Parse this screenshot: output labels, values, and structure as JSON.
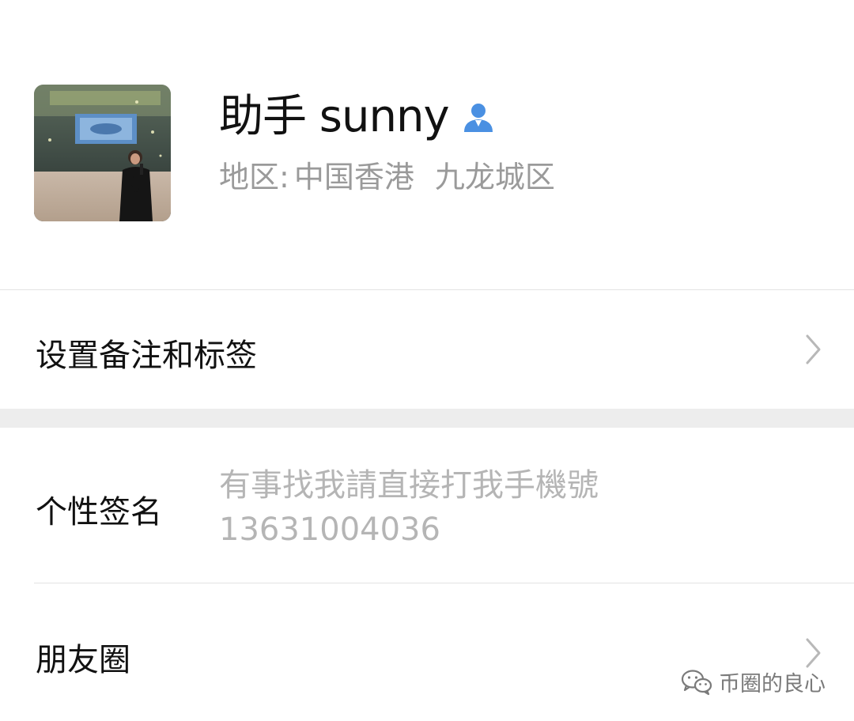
{
  "profile": {
    "name": "助手 sunny",
    "region_label": "地区:",
    "region_value": "中国香港",
    "region_district": "九龙城区",
    "avatar": "avatar-photo-singer-on-stage",
    "gender_icon": "person-icon",
    "gender_icon_color": "#4a90e2"
  },
  "rows": {
    "remark_label": "设置备注和标签",
    "signature_label": "个性签名",
    "signature_line1": "有事找我請直接打我手機號",
    "signature_line2": "13631004036",
    "moments_label": "朋友圈"
  },
  "watermark": {
    "text": "币圈的良心",
    "icon": "wechat-icon"
  }
}
